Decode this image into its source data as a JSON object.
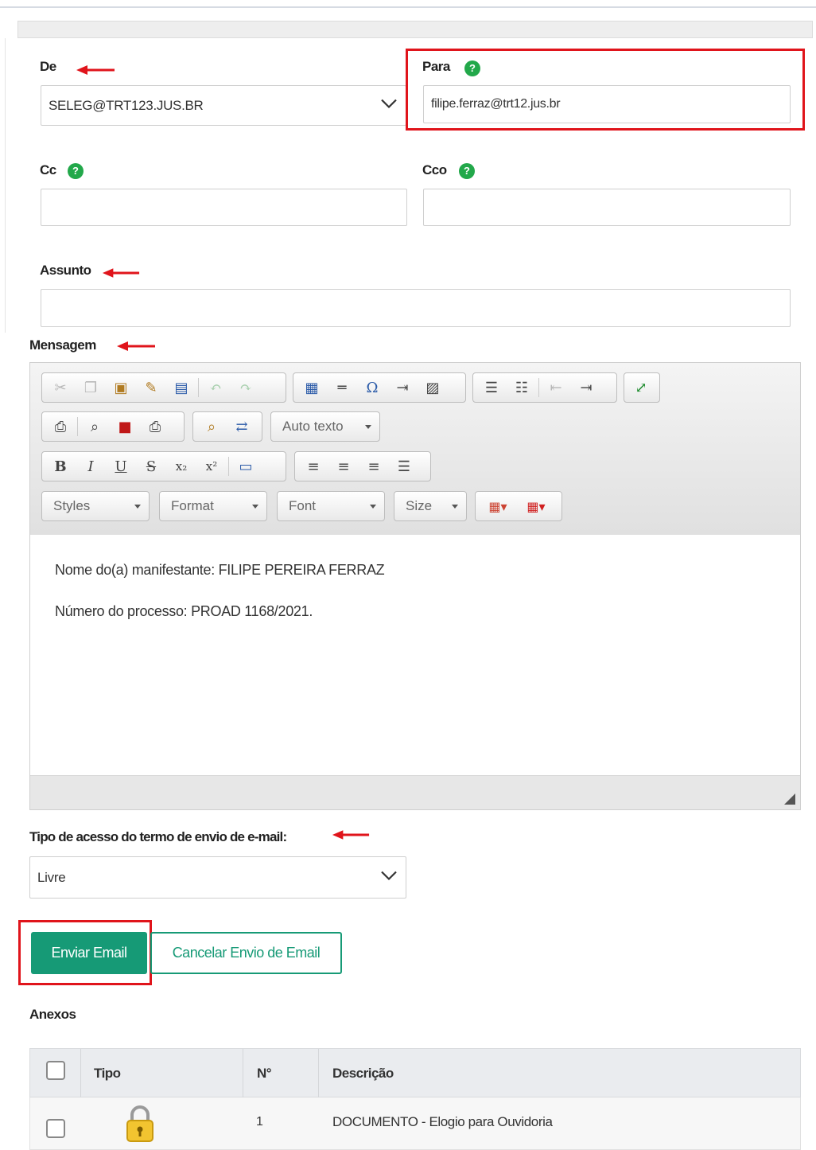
{
  "form": {
    "de": {
      "label": "De",
      "value": "SELEG@TRT123.JUS.BR"
    },
    "para": {
      "label": "Para",
      "value": "filipe.ferraz@trt12.jus.br"
    },
    "cc": {
      "label": "Cc",
      "value": ""
    },
    "cco": {
      "label": "Cco",
      "value": ""
    },
    "assunto": {
      "label": "Assunto",
      "value": ""
    },
    "mensagem": {
      "label": "Mensagem"
    },
    "help_glyph": "?"
  },
  "editor": {
    "combos": {
      "auto_texto": "Auto texto",
      "styles": "Styles",
      "format": "Format",
      "font": "Font",
      "size": "Size"
    },
    "toolbar_icons": [
      "cut-icon",
      "copy-icon",
      "paste-icon",
      "paste-text-icon",
      "paste-word-icon",
      "undo-icon",
      "redo-icon",
      "table-icon",
      "horizontal-rule-icon",
      "special-char-icon",
      "page-break-icon",
      "image-icon",
      "numbered-list-icon",
      "bulleted-list-icon",
      "outdent-icon",
      "indent-icon",
      "maximize-icon",
      "source-icon",
      "preview-icon",
      "pdf-icon",
      "print-icon",
      "find-icon",
      "replace-icon",
      "bold-icon",
      "italic-icon",
      "underline-icon",
      "strike-icon",
      "subscript-icon",
      "superscript-icon",
      "remove-format-icon",
      "align-left-icon",
      "align-center-icon",
      "align-right-icon",
      "justify-icon",
      "text-color-icon",
      "background-color-icon"
    ],
    "format_glyphs": {
      "bold": "B",
      "italic": "I",
      "underline": "U",
      "strike": "S",
      "subscript": "x₂",
      "superscript": "x²",
      "omega": "Ω"
    },
    "content": [
      "Nome do(a) manifestante: FILIPE PEREIRA FERRAZ",
      "Número do processo: PROAD 1168/2021."
    ]
  },
  "access": {
    "label": "Tipo de acesso do termo de envio de e-mail:",
    "value": "Livre"
  },
  "buttons": {
    "send": "Enviar Email",
    "cancel": "Cancelar Envio de Email"
  },
  "attachments": {
    "title": "Anexos",
    "columns": [
      "Tipo",
      "N°",
      "Descrição"
    ],
    "rows": [
      {
        "numero": "1",
        "descricao": "DOCUMENTO - Elogio para Ouvidoria",
        "tipo_icon": "lock-icon"
      }
    ]
  },
  "colors": {
    "primary": "#169a76",
    "help": "#22a84a",
    "highlight": "#e0141b",
    "annotation_arrow": "#e0141b"
  }
}
